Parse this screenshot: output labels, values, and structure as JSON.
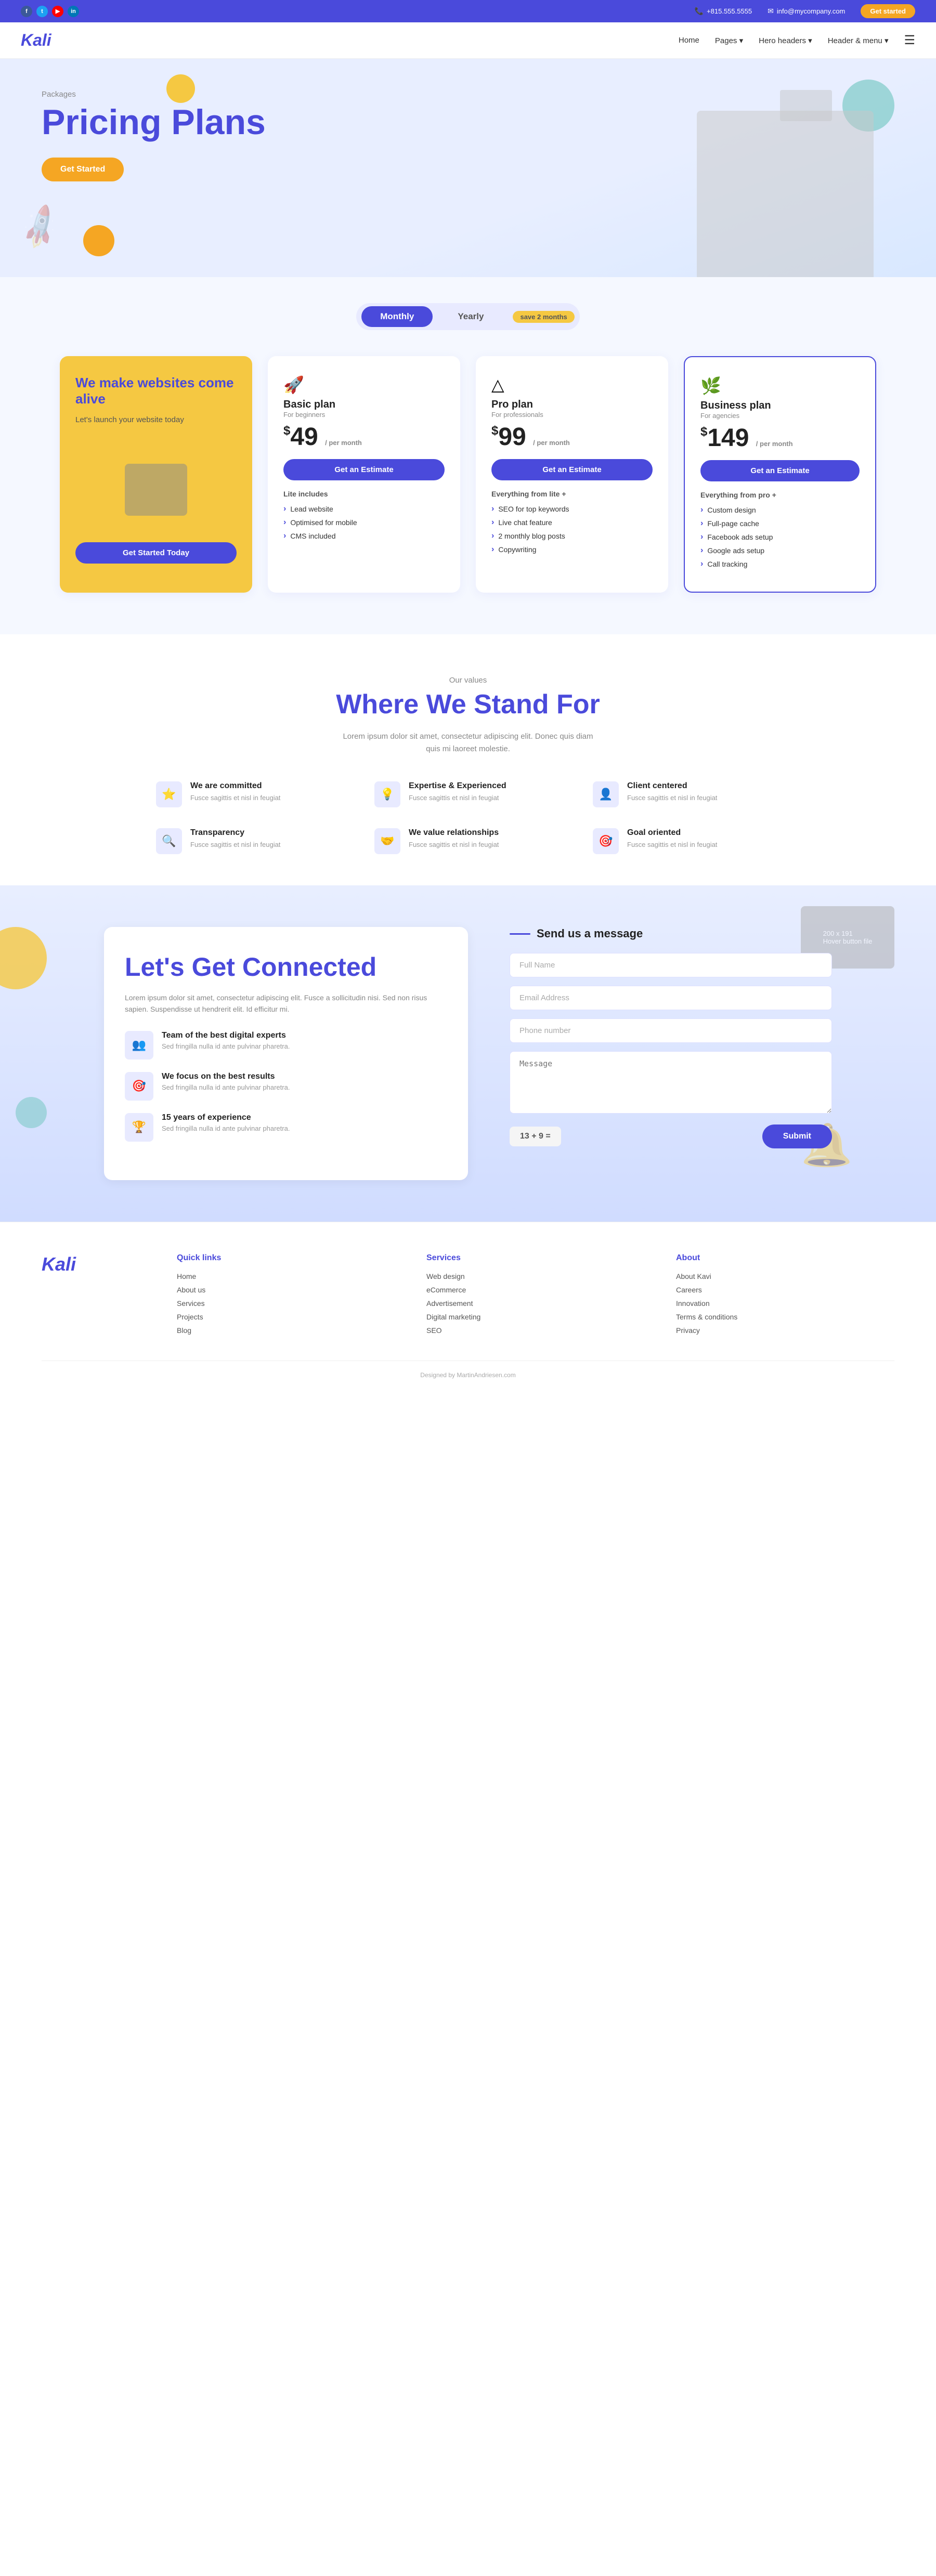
{
  "topbar": {
    "phone": "+815.555.5555",
    "email": "info@mycompany.com",
    "cta_label": "Get started",
    "socials": [
      "f",
      "t",
      "y",
      "in"
    ]
  },
  "navbar": {
    "logo": "Kali",
    "links": [
      "Home",
      "Pages",
      "Hero headers",
      "Header & menu"
    ],
    "hamburger": "☰"
  },
  "hero": {
    "tag": "Packages",
    "title": "Pricing Plans",
    "btn_label": "Get Started"
  },
  "pricing_toggle": {
    "monthly_label": "Monthly",
    "yearly_label": "Yearly",
    "save_label": "save 2 months"
  },
  "pricing_cards": {
    "highlight": {
      "title": "We make websites come alive",
      "subtitle": "Let's launch your website today",
      "cta": "Get Started Today"
    },
    "basic": {
      "icon": "🚀",
      "name": "Basic plan",
      "subtitle": "For beginners",
      "price": "49",
      "period": "/ per month",
      "btn": "Get an Estimate",
      "includes_label": "Lite includes",
      "features": [
        "Lead website",
        "Optimised for mobile",
        "CMS included"
      ]
    },
    "pro": {
      "icon": "△",
      "name": "Pro plan",
      "subtitle": "For professionals",
      "price": "99",
      "period": "/ per month",
      "btn": "Get an Estimate",
      "includes_label": "Everything from lite +",
      "features": [
        "SEO for top keywords",
        "Live chat feature",
        "2 monthly blog posts",
        "Copywriting"
      ]
    },
    "business": {
      "icon": "🌿",
      "name": "Business plan",
      "subtitle": "For agencies",
      "price": "149",
      "period": "/ per month",
      "btn": "Get an Estimate",
      "includes_label": "Everything from pro +",
      "features": [
        "Custom design",
        "Full-page cache",
        "Facebook ads setup",
        "Google ads setup",
        "Call tracking"
      ]
    }
  },
  "values": {
    "tag": "Our values",
    "title": "Where We Stand For",
    "desc": "Lorem ipsum dolor sit amet, consectetur adipiscing elit. Donec quis diam quis mi laoreet molestie.",
    "items": [
      {
        "title": "We are committed",
        "desc": "Fusce sagittis et nisl in feugiat"
      },
      {
        "title": "Expertise & Experienced",
        "desc": "Fusce sagittis et nisl in feugiat"
      },
      {
        "title": "Client centered",
        "desc": "Fusce sagittis et nisl in feugiat"
      },
      {
        "title": "Transparency",
        "desc": "Fusce sagittis et nisl in feugiat"
      },
      {
        "title": "We value relationships",
        "desc": "Fusce sagittis et nisl in feugiat"
      },
      {
        "title": "Goal oriented",
        "desc": "Fusce sagittis et nisl in feugiat"
      }
    ]
  },
  "connect": {
    "title": "Let's Get Connected",
    "desc": "Lorem ipsum dolor sit amet, consectetur adipiscing elit. Fusce a sollicitudin nisi. Sed non risus sapien. Suspendisse ut hendrerit elit. Id efficitur mi.",
    "team_items": [
      {
        "title": "Team of the best digital experts",
        "desc": "Sed fringilla nulla id ante pulvinar pharetra."
      },
      {
        "title": "We focus on the best results",
        "desc": "Sed fringilla nulla id ante pulvinar pharetra."
      },
      {
        "title": "15 years of experience",
        "desc": "Sed fringilla nulla id ante pulvinar pharetra."
      }
    ],
    "form": {
      "title": "Send us a message",
      "full_name_placeholder": "Full Name",
      "email_placeholder": "Email Address",
      "phone_placeholder": "Phone number",
      "message_placeholder": "Message",
      "captcha": "13 + 9 =",
      "submit_label": "Submit"
    },
    "deco_img_label": "200 x 191\nHover button file"
  },
  "footer": {
    "logo": "Kali",
    "quick_links": {
      "title": "Quick links",
      "items": [
        "Home",
        "About us",
        "Services",
        "Projects",
        "Blog"
      ]
    },
    "services": {
      "title": "Services",
      "items": [
        "Web design",
        "eCommerce",
        "Advertisement",
        "Digital marketing",
        "SEO"
      ]
    },
    "about": {
      "title": "About",
      "items": [
        "About Kavi",
        "Careers",
        "Innovation",
        "Terms & conditions",
        "Privacy"
      ]
    },
    "bottom": "Designed by MartinAndriesen.com"
  }
}
